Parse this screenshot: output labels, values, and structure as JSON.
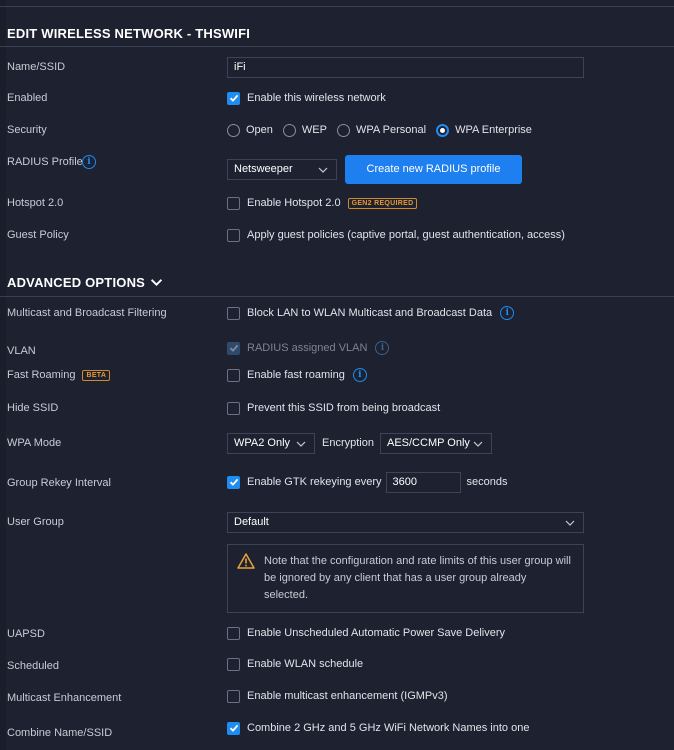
{
  "page": {
    "title": "EDIT WIRELESS NETWORK - THSWIFI",
    "advanced_title": "ADVANCED OPTIONS"
  },
  "basic": {
    "name_label": "Name/SSID",
    "name_value": "iFi",
    "enabled_label": "Enabled",
    "enabled_checkbox": "Enable this wireless network",
    "security_label": "Security",
    "security_options": [
      "Open",
      "WEP",
      "WPA Personal",
      "WPA Enterprise"
    ],
    "security_selected": "WPA Enterprise",
    "radius_label": "RADIUS Profile",
    "radius_value": "Netsweeper",
    "radius_button": "Create new RADIUS profile",
    "hotspot_label": "Hotspot 2.0",
    "hotspot_checkbox": "Enable Hotspot 2.0",
    "hotspot_badge": "GEN2 REQUIRED",
    "guest_label": "Guest Policy",
    "guest_checkbox": "Apply guest policies (captive portal, guest authentication, access)"
  },
  "advanced": {
    "multicast_label": "Multicast and Broadcast Filtering",
    "multicast_checkbox": "Block LAN to WLAN Multicast and Broadcast Data",
    "vlan_label": "VLAN",
    "vlan_checkbox": "RADIUS assigned VLAN",
    "fast_roaming_label": "Fast Roaming",
    "fast_roaming_badge": "BETA",
    "fast_roaming_checkbox": "Enable fast roaming",
    "hide_ssid_label": "Hide SSID",
    "hide_ssid_checkbox": "Prevent this SSID from being broadcast",
    "wpa_mode_label": "WPA Mode",
    "wpa_mode_value": "WPA2 Only",
    "encryption_label": "Encryption",
    "encryption_value": "AES/CCMP Only",
    "rekey_label": "Group Rekey Interval",
    "rekey_checkbox": "Enable GTK rekeying every",
    "rekey_value": "3600",
    "rekey_unit": "seconds",
    "user_group_label": "User Group",
    "user_group_value": "Default",
    "notice_text": "Note that the configuration and rate limits of this user group will be ignored by any client that has a user group already selected.",
    "uapsd_label": "UAPSD",
    "uapsd_checkbox": "Enable Unscheduled Automatic Power Save Delivery",
    "scheduled_label": "Scheduled",
    "scheduled_checkbox": "Enable WLAN schedule",
    "mcast_enh_label": "Multicast Enhancement",
    "mcast_enh_checkbox": "Enable multicast enhancement (IGMPv3)",
    "combine_label": "Combine Name/SSID",
    "combine_checkbox": "Combine 2 GHz and 5 GHz WiFi Network Names into one"
  },
  "colors": {
    "background": "#1d2130",
    "accent": "#1e8cf0",
    "badge": "#e59a34",
    "warning": "#e8a33a"
  },
  "icons": {
    "info": "info-icon",
    "chevron": "chevron-down-icon",
    "warning": "warning-icon",
    "check": "checkmark-icon"
  }
}
